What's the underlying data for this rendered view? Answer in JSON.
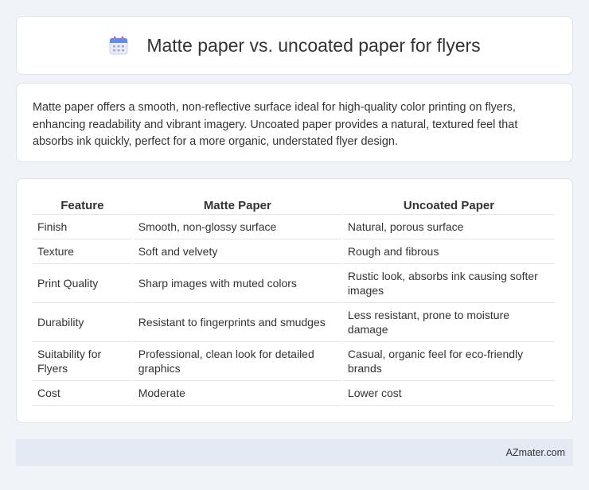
{
  "header": {
    "title": "Matte paper vs. uncoated paper for flyers",
    "icon": "calendar-icon"
  },
  "description": {
    "text": "Matte paper offers a smooth, non-reflective surface ideal for high-quality color printing on flyers, enhancing readability and vibrant imagery. Uncoated paper provides a natural, textured feel that absorbs ink quickly, perfect for a more organic, understated flyer design."
  },
  "table": {
    "headers": [
      "Feature",
      "Matte Paper",
      "Uncoated Paper"
    ],
    "rows": [
      [
        "Finish",
        "Smooth, non-glossy surface",
        "Natural, porous surface"
      ],
      [
        "Texture",
        "Soft and velvety",
        "Rough and fibrous"
      ],
      [
        "Print Quality",
        "Sharp images with muted colors",
        "Rustic look, absorbs ink causing softer images"
      ],
      [
        "Durability",
        "Resistant to fingerprints and smudges",
        "Less resistant, prone to moisture damage"
      ],
      [
        "Suitability for Flyers",
        "Professional, clean look for detailed graphics",
        "Casual, organic feel for eco-friendly brands"
      ],
      [
        "Cost",
        "Moderate",
        "Lower cost"
      ]
    ]
  },
  "footer": {
    "text": "AZmater.com"
  },
  "colors": {
    "background": "#f0f3f8",
    "card": "#ffffff",
    "footer_bg": "#e4eaf4",
    "text": "#333333"
  }
}
